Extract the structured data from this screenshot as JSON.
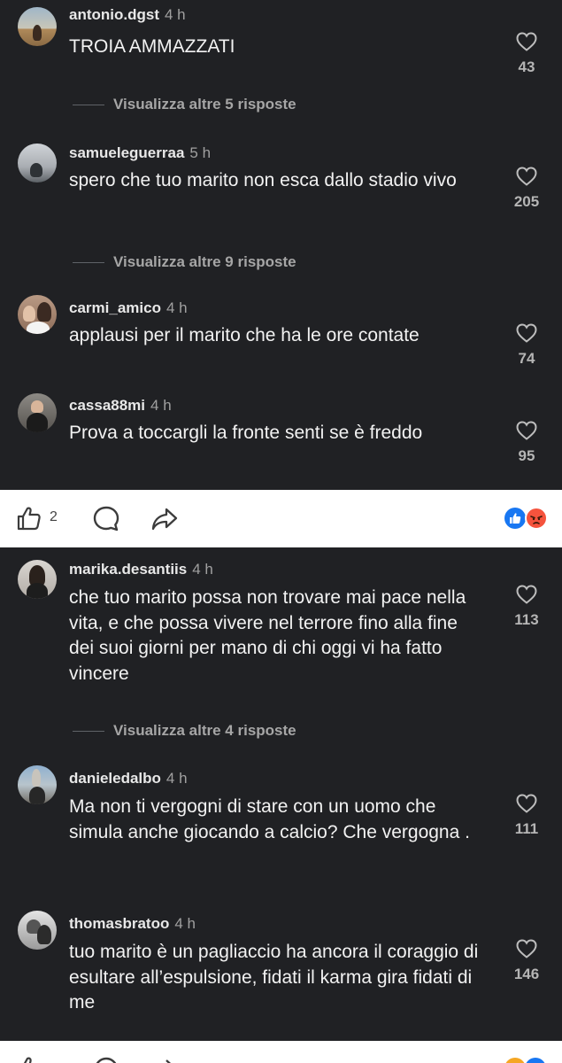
{
  "top_comments": [
    {
      "username": "antonio.dgst",
      "time": "4 h",
      "text": "TROIA AMMAZZATI",
      "likes": "43",
      "avatar": "beach-photo-avatar"
    },
    {
      "username": "samueleguerraa",
      "time": "5 h",
      "text": "spero che tuo marito non esca dallo stadio vivo",
      "likes": "205",
      "avatar": "grey-photo-avatar"
    },
    {
      "username": "carmi_amico",
      "time": "4 h",
      "text": "applausi per il marito che ha le ore contate",
      "likes": "74",
      "avatar": "couple-photo-avatar"
    },
    {
      "username": "cassa88mi",
      "time": "4 h",
      "text": "Prova a toccargli la fronte senti se è freddo",
      "likes": "95",
      "avatar": "suit-photo-avatar"
    }
  ],
  "top_more_replies": [
    {
      "label": "Visualizza altre 5 risposte"
    },
    {
      "label": "Visualizza altre 9 risposte"
    }
  ],
  "action_bar": {
    "like_count": "2",
    "icons": [
      "thumbs-up-icon",
      "comment-icon",
      "share-icon"
    ],
    "reactions": [
      "like-reaction-icon",
      "angry-reaction-icon"
    ],
    "reaction_colors": {
      "like": "#1877f2",
      "angry": "#f5533d"
    }
  },
  "bottom_comments": [
    {
      "username": "marika.desantiis",
      "time": "4 h",
      "text": "che tuo marito possa non trovare mai pace nella vita, e che possa vivere nel terrore fino alla fine dei suoi giorni per mano di chi oggi vi ha fatto vincere",
      "likes": "113",
      "avatar": "woman-photo-avatar"
    },
    {
      "username": "danieledalbo",
      "time": "4 h",
      "text": "Ma non ti vergogni di stare con un uomo che simula anche giocando a calcio? Che vergogna .",
      "likes": "111",
      "avatar": "city-photo-avatar"
    },
    {
      "username": "thomasbratoo",
      "time": "4 h",
      "text": "tuo marito è un pagliaccio ha ancora il coraggio di esultare all’espulsione, fidati il karma gira fidati di me",
      "likes": "146",
      "avatar": "bw-photo-avatar"
    }
  ],
  "bottom_more_replies": [
    {
      "label": "Visualizza altre 4 risposte"
    }
  ],
  "colors": {
    "background": "#202124",
    "text": "#f2f2f2",
    "muted": "#a6a6a6"
  }
}
